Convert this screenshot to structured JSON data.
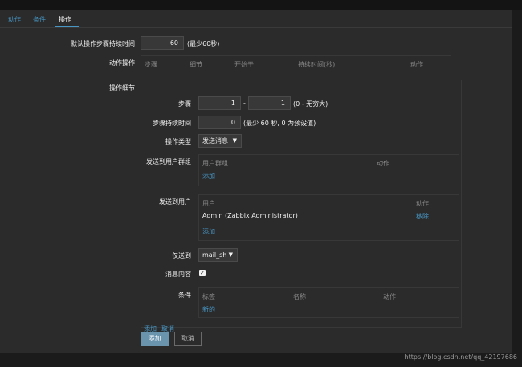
{
  "tabs": [
    {
      "label": "动作"
    },
    {
      "label": "条件"
    },
    {
      "label": "操作"
    }
  ],
  "default_step_duration": {
    "label": "默认操作步骤持续时间",
    "value": "60",
    "hint": "(最少60秒)"
  },
  "action_operations": {
    "label": "动作操作",
    "columns": [
      "步骤",
      "细节",
      "开始于",
      "持续时间(秒)",
      "动作"
    ]
  },
  "operation_details": {
    "label": "操作细节",
    "steps": {
      "label": "步骤",
      "from": "1",
      "separator": "-",
      "to": "1",
      "hint": "(0 - 无穷大)"
    },
    "step_duration": {
      "label": "步骤持续时间",
      "value": "0",
      "hint": "(最少 60 秒, 0 为预设值)"
    },
    "operation_type": {
      "label": "操作类型",
      "value": "发送消息"
    },
    "send_to_groups": {
      "label": "发送到用户群组",
      "columns": [
        "用户群组",
        "动作"
      ],
      "add_link": "添加"
    },
    "send_to_users": {
      "label": "发送到用户",
      "columns": [
        "用户",
        "动作"
      ],
      "rows": [
        {
          "user": "Admin (Zabbix Administrator)",
          "action": "移除"
        }
      ],
      "add_link": "添加"
    },
    "send_only_to": {
      "label": "仅送到",
      "value": "mail_sh"
    },
    "message_content": {
      "label": "消息内容",
      "checked": true
    },
    "conditions": {
      "label": "条件",
      "columns": [
        "标签",
        "名称",
        "动作"
      ],
      "new_link": "新的"
    },
    "add_link": "添加",
    "cancel_link": "取消"
  },
  "buttons": {
    "add": "添加",
    "cancel": "取消"
  },
  "watermark": "https://blog.csdn.net/qq_42197686",
  "colors": {
    "link": "#4796c4",
    "primary_button": "#6a93ad",
    "panel": "#2b2b2b"
  }
}
